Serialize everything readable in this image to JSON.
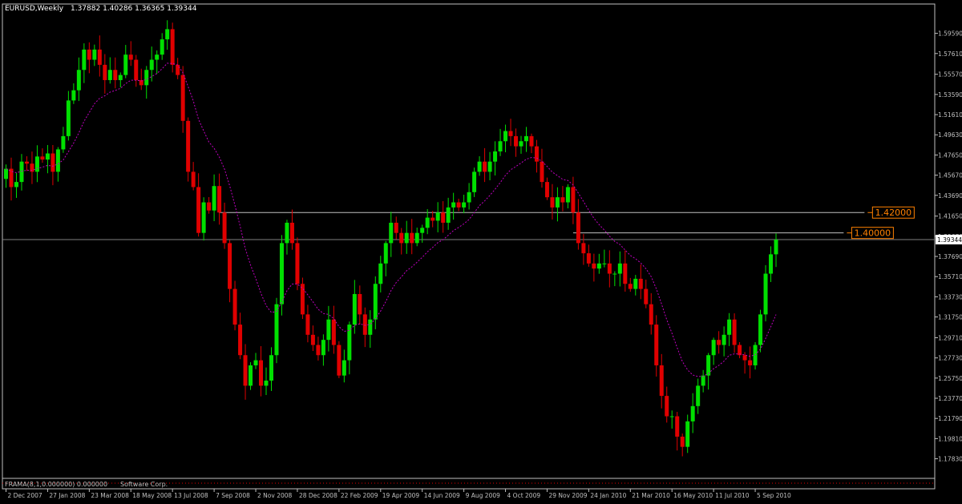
{
  "header": {
    "symbol": "EURUSD,Weekly",
    "ohlc": "1.37882 1.40286 1.36365 1.39344"
  },
  "footer": {
    "indicator": "FRAMA(8,1,0.000000) 0.000000",
    "copyright": "Software Corp."
  },
  "colors": {
    "background": "#000000",
    "bull": "#00e000",
    "bear": "#e00000",
    "ma": "#c000c0",
    "axis": "#c0c0c0",
    "level": "#c0c0c0",
    "level_label": "#ff8000"
  },
  "chart_data": {
    "type": "candlestick",
    "title": "EURUSD,Weekly",
    "ylim": [
      1.1685,
      1.6129
    ],
    "y_ticks": [
      "1.59590",
      "1.57610",
      "1.55570",
      "1.53590",
      "1.51610",
      "1.49630",
      "1.47650",
      "1.45670",
      "1.43690",
      "1.41650",
      "1.39670",
      "1.37690",
      "1.35710",
      "1.33730",
      "1.31750",
      "1.29710",
      "1.27730",
      "1.25750",
      "1.23770",
      "1.21790",
      "1.19810",
      "1.17830"
    ],
    "x_labels": [
      {
        "bar": 0,
        "label": "2 Dec 2007"
      },
      {
        "bar": 8,
        "label": "27 Jan 2008"
      },
      {
        "bar": 16,
        "label": "23 Mar 2008"
      },
      {
        "bar": 24,
        "label": "18 May 2008"
      },
      {
        "bar": 32,
        "label": "13 Jul 2008"
      },
      {
        "bar": 40,
        "label": "7 Sep 2008"
      },
      {
        "bar": 48,
        "label": "2 Nov 2008"
      },
      {
        "bar": 56,
        "label": "28 Dec 2008"
      },
      {
        "bar": 64,
        "label": "22 Feb 2009"
      },
      {
        "bar": 72,
        "label": "19 Apr 2009"
      },
      {
        "bar": 80,
        "label": "14 Jun 2009"
      },
      {
        "bar": 88,
        "label": "9 Aug 2009"
      },
      {
        "bar": 96,
        "label": "4 Oct 2009"
      },
      {
        "bar": 104,
        "label": "29 Nov 2009"
      },
      {
        "bar": 112,
        "label": "24 Jan 2010"
      },
      {
        "bar": 120,
        "label": "21 Mar 2010"
      },
      {
        "bar": 128,
        "label": "16 May 2010"
      },
      {
        "bar": 136,
        "label": "11 Jul 2010"
      },
      {
        "bar": 144,
        "label": "5 Sep 2010"
      }
    ],
    "closes": [
      1.463,
      1.445,
      1.45,
      1.47,
      1.468,
      1.46,
      1.475,
      1.472,
      1.478,
      1.46,
      1.482,
      1.495,
      1.53,
      1.54,
      1.56,
      1.58,
      1.57,
      1.58,
      1.565,
      1.55,
      1.56,
      1.55,
      1.555,
      1.575,
      1.57,
      1.55,
      1.545,
      1.56,
      1.57,
      1.575,
      1.59,
      1.6,
      1.565,
      1.555,
      1.51,
      1.46,
      1.445,
      1.4,
      1.43,
      1.422,
      1.446,
      1.42,
      1.39,
      1.345,
      1.31,
      1.28,
      1.25,
      1.27,
      1.275,
      1.25,
      1.255,
      1.28,
      1.33,
      1.39,
      1.41,
      1.39,
      1.35,
      1.32,
      1.3,
      1.29,
      1.28,
      1.295,
      1.315,
      1.29,
      1.26,
      1.275,
      1.31,
      1.34,
      1.32,
      1.3,
      1.315,
      1.35,
      1.37,
      1.39,
      1.41,
      1.4,
      1.39,
      1.4,
      1.39,
      1.4,
      1.405,
      1.415,
      1.412,
      1.42,
      1.41,
      1.425,
      1.43,
      1.425,
      1.43,
      1.44,
      1.46,
      1.47,
      1.46,
      1.47,
      1.48,
      1.49,
      1.5,
      1.495,
      1.485,
      1.49,
      1.495,
      1.485,
      1.47,
      1.45,
      1.435,
      1.425,
      1.435,
      1.43,
      1.445,
      1.42,
      1.39,
      1.38,
      1.37,
      1.365,
      1.37,
      1.37,
      1.36,
      1.36,
      1.37,
      1.35,
      1.345,
      1.355,
      1.345,
      1.33,
      1.31,
      1.27,
      1.24,
      1.22,
      1.22,
      1.2,
      1.19,
      1.215,
      1.23,
      1.25,
      1.26,
      1.28,
      1.295,
      1.29,
      1.3,
      1.315,
      1.29,
      1.28,
      1.275,
      1.27,
      1.29,
      1.32,
      1.36,
      1.379,
      1.3934
    ],
    "ma_series": "FRAMA(8,1,0.000000)",
    "levels": [
      {
        "price": 1.42,
        "label": "1.42000",
        "from_bar": 41,
        "to_bar": 165
      },
      {
        "price": 1.4,
        "label": "1.40000",
        "from_bar": 109,
        "to_bar": 161
      }
    ],
    "current_price": {
      "price": 1.39344,
      "label": "1.39344"
    }
  }
}
